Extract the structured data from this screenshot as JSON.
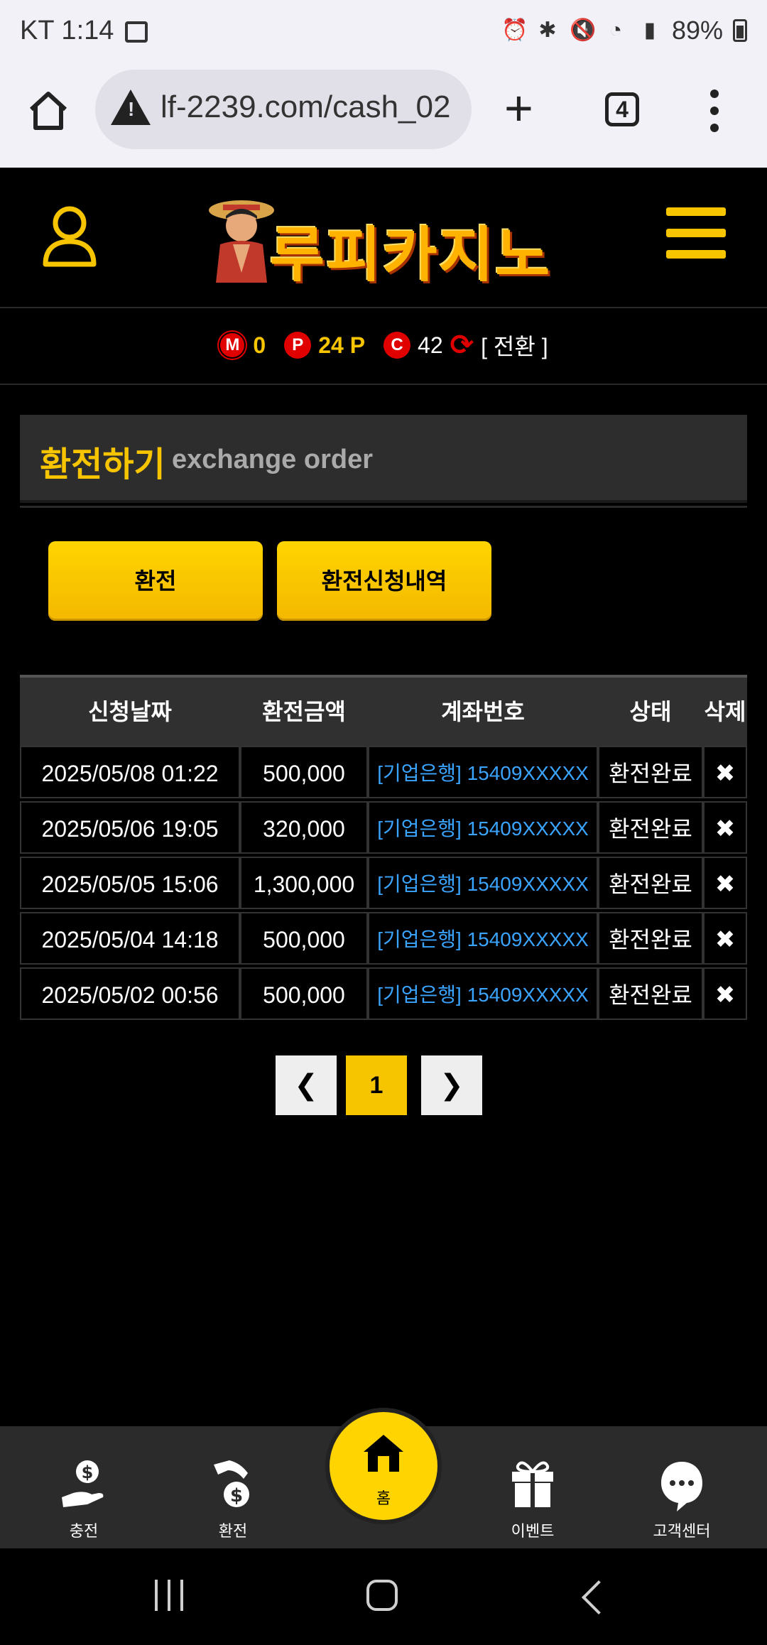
{
  "status_bar": {
    "carrier_time": "KT 1:14",
    "battery": "89%"
  },
  "browser": {
    "url": "lf-2239.com/cash_02",
    "tab_count": "4"
  },
  "site": {
    "logo_text": "루피카지노"
  },
  "points": {
    "m_badge": "M",
    "m_value": "0",
    "p_badge": "P",
    "p_value": "24 P",
    "c_badge": "C",
    "c_value": "42",
    "convert_label": "[ 전환 ]"
  },
  "page": {
    "title_ko": "환전하기",
    "title_en": "exchange order"
  },
  "buttons": {
    "exchange": "환전",
    "history": "환전신청내역"
  },
  "table": {
    "headers": [
      "신청날짜",
      "환전금액",
      "계좌번호",
      "상태",
      "삭제"
    ],
    "rows": [
      {
        "date": "2025/05/08 01:22",
        "amount": "500,000",
        "account": "[기업은행] 15409XXXXX",
        "status": "환전완료",
        "delete": "✖"
      },
      {
        "date": "2025/05/06 19:05",
        "amount": "320,000",
        "account": "[기업은행] 15409XXXXX",
        "status": "환전완료",
        "delete": "✖"
      },
      {
        "date": "2025/05/05 15:06",
        "amount": "1,300,000",
        "account": "[기업은행] 15409XXXXX",
        "status": "환전완료",
        "delete": "✖"
      },
      {
        "date": "2025/05/04 14:18",
        "amount": "500,000",
        "account": "[기업은행] 15409XXXXX",
        "status": "환전완료",
        "delete": "✖"
      },
      {
        "date": "2025/05/02 00:56",
        "amount": "500,000",
        "account": "[기업은행] 15409XXXXX",
        "status": "환전완료",
        "delete": "✖"
      }
    ]
  },
  "pagination": {
    "current": "1"
  },
  "bottom_nav": {
    "charge": "충전",
    "exchange": "환전",
    "home": "홈",
    "event": "이벤트",
    "support": "고객센터"
  },
  "colors": {
    "accent": "#f7c400",
    "badge_red": "#e00000",
    "link_blue": "#3aa4ff"
  },
  "icons": [
    "home-icon",
    "warning-icon",
    "plus-icon",
    "tabs-icon",
    "menu-dots-icon",
    "user-icon",
    "hamburger-icon",
    "refresh-icon",
    "chevron-left-icon",
    "chevron-right-icon",
    "delete-icon",
    "charge-icon",
    "exchange-icon",
    "gift-icon",
    "headset-icon"
  ]
}
